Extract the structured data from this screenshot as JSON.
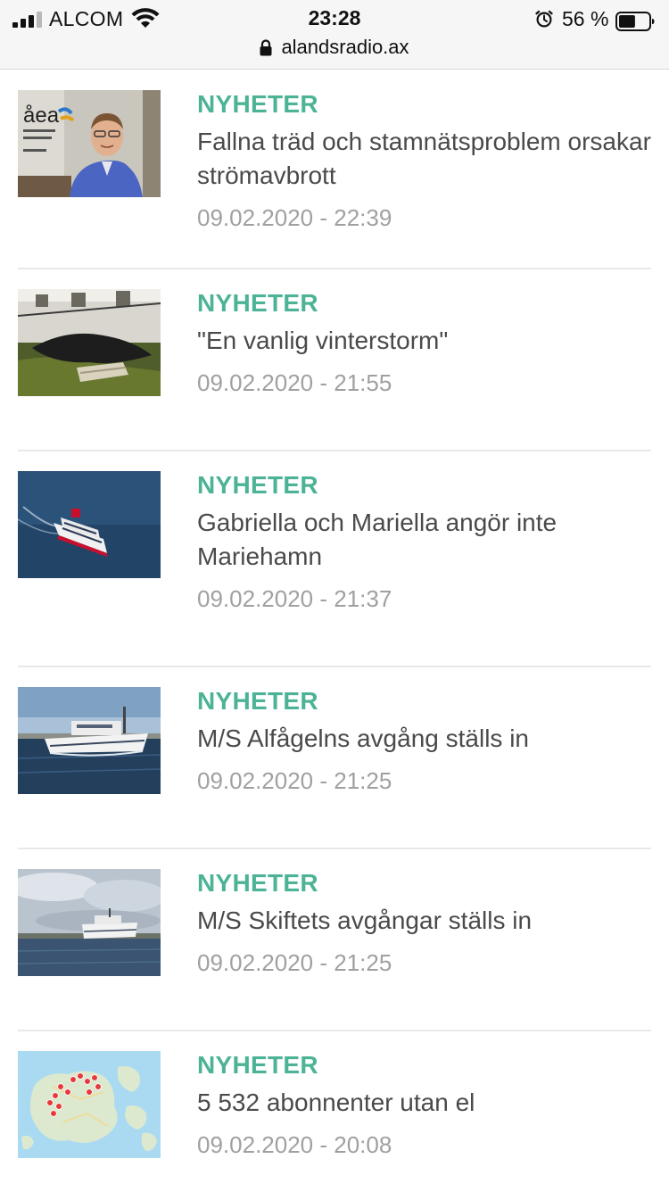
{
  "status_bar": {
    "carrier": "ALCOM",
    "time": "23:28",
    "battery": "56 %",
    "battery_level": 0.56
  },
  "address_bar": {
    "url": "alandsradio.ax"
  },
  "articles": [
    {
      "category": "NYHETER",
      "title": "Fallna träd och stamnätsproblem orsakar strömavbrott",
      "date": "09.02.2020 - 22:39"
    },
    {
      "category": "NYHETER",
      "title": "\"En vanlig vinterstorm\"",
      "date": "09.02.2020 - 21:55"
    },
    {
      "category": "NYHETER",
      "title": "Gabriella och Mariella angör inte Mariehamn",
      "date": "09.02.2020 - 21:37"
    },
    {
      "category": "NYHETER",
      "title": "M/S Alfågelns avgång ställs in",
      "date": "09.02.2020 - 21:25"
    },
    {
      "category": "NYHETER",
      "title": "M/S Skiftets avgångar ställs in",
      "date": "09.02.2020 - 21:25"
    },
    {
      "category": "NYHETER",
      "title": "5 532 abonnenter utan el",
      "date": "09.02.2020 - 20:08"
    }
  ]
}
